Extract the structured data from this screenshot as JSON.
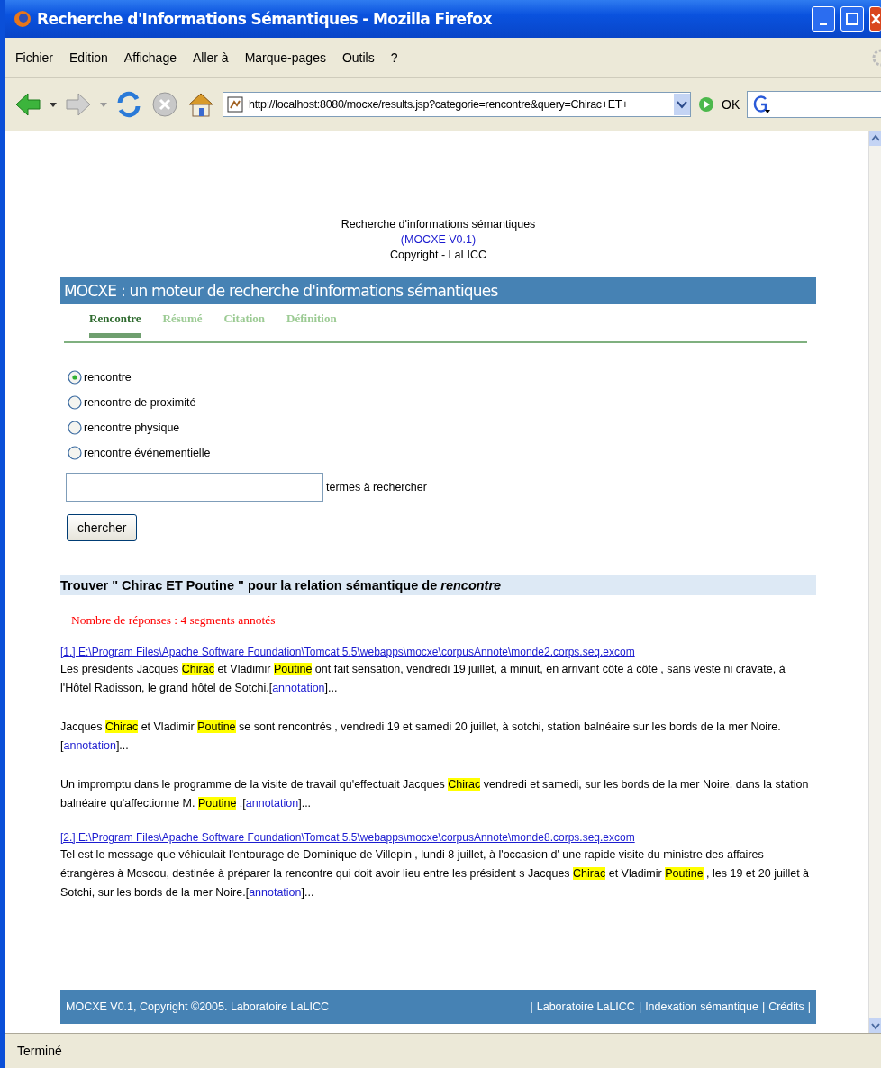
{
  "window": {
    "title": "Recherche d'Informations Sémantiques - Mozilla Firefox"
  },
  "menu": [
    "Fichier",
    "Edition",
    "Affichage",
    "Aller à",
    "Marque-pages",
    "Outils",
    "?"
  ],
  "toolbar": {
    "url": "http://localhost:8080/mocxe/results.jsp?categorie=rencontre&query=Chirac+ET+",
    "go_label": "OK"
  },
  "header": {
    "line_1": "Recherche d'informations sémantiques",
    "version_link": "(MOCXE V0.1)",
    "copyright": "Copyright - LaLICC"
  },
  "banner": {
    "title": "MOCXE : un moteur de recherche d'informations sémantiques"
  },
  "tabs": [
    {
      "label": "Rencontre",
      "selected": true
    },
    {
      "label": "Résumé",
      "selected": false
    },
    {
      "label": "Citation",
      "selected": false
    },
    {
      "label": "Définition",
      "selected": false
    }
  ],
  "radios": [
    {
      "label": "rencontre",
      "selected": true
    },
    {
      "label": "rencontre de proximité",
      "selected": false
    },
    {
      "label": "rencontre physique",
      "selected": false
    },
    {
      "label": "rencontre événementielle",
      "selected": false
    }
  ],
  "search": {
    "label": "termes à rechercher",
    "button": "chercher"
  },
  "results": {
    "heading": "Trouver \" Chirac ET Poutine \" pour la relation sémantique de *rencontre*",
    "count": "Nombre de réponses : 4 segments annotés",
    "documents": [
      {
        "link": "[1.] E:\\Program Files\\Apache Software Foundation\\Tomcat 5.5\\webapps\\mocxe\\corpusAnnote\\monde2.corps.seq.excom",
        "snippets": [
          [
            {
              "kind": "plain",
              "text": "Les présidents Jacques "
            },
            {
              "kind": "highlight",
              "text": "Chirac"
            },
            {
              "kind": "plain",
              "text": " et Vladimir "
            },
            {
              "kind": "highlight",
              "text": "Poutine"
            },
            {
              "kind": "plain",
              "text": " ont fait sensation, vendredi 19 juillet, à minuit, en arrivant côte à côte , sans veste ni cravate, à l'Hôtel Radisson, le grand hôtel de Sotchi.["
            },
            {
              "kind": "link",
              "text": "annotation"
            },
            {
              "kind": "plain",
              "text": "]..."
            }
          ],
          [
            {
              "kind": "plain",
              "text": "Jacques "
            },
            {
              "kind": "highlight",
              "text": "Chirac"
            },
            {
              "kind": "plain",
              "text": " et Vladimir "
            },
            {
              "kind": "highlight",
              "text": "Poutine"
            },
            {
              "kind": "plain",
              "text": " se sont rencontrés , vendredi 19 et samedi 20 juillet, à sotchi, station balnéaire sur les bords de la mer Noire.["
            },
            {
              "kind": "link",
              "text": "annotation"
            },
            {
              "kind": "plain",
              "text": "]..."
            }
          ],
          [
            {
              "kind": "plain",
              "text": "Un impromptu dans le programme de la visite de travail qu'effectuait Jacques "
            },
            {
              "kind": "highlight",
              "text": "Chirac"
            },
            {
              "kind": "plain",
              "text": " vendredi et samedi, sur les bords de la mer Noire, dans la station balnéaire qu'affectionne M. "
            },
            {
              "kind": "highlight",
              "text": "Poutine"
            },
            {
              "kind": "plain",
              "text": " .["
            },
            {
              "kind": "link",
              "text": "annotation"
            },
            {
              "kind": "plain",
              "text": "]..."
            }
          ]
        ]
      },
      {
        "link": "[2.] E:\\Program Files\\Apache Software Foundation\\Tomcat 5.5\\webapps\\mocxe\\corpusAnnote\\monde8.corps.seq.excom",
        "snippets": [
          [
            {
              "kind": "plain",
              "text": "Tel est le message que véhiculait l'entourage de Dominique de Villepin , lundi 8 juillet, à l'occasion d' une rapide visite du ministre des affaires étrangères à Moscou, destinée à préparer la rencontre qui doit avoir lieu entre les président s Jacques "
            },
            {
              "kind": "highlight",
              "text": "Chirac"
            },
            {
              "kind": "plain",
              "text": " et Vladimir "
            },
            {
              "kind": "highlight",
              "text": "Poutine"
            },
            {
              "kind": "plain",
              "text": " , les 19 et 20 juillet à Sotchi, sur les bords de la mer Noire.["
            },
            {
              "kind": "link",
              "text": "annotation"
            },
            {
              "kind": "plain",
              "text": "]..."
            }
          ]
        ]
      }
    ]
  },
  "footer": {
    "text": "MOCXE V0.1, Copyright ©2005. Laboratoire LaLICC",
    "separator": "|",
    "links": [
      "Laboratoire LaLICC",
      "Indexation sémantique",
      "Crédits"
    ]
  },
  "status_bar": {
    "text": "Terminé"
  }
}
